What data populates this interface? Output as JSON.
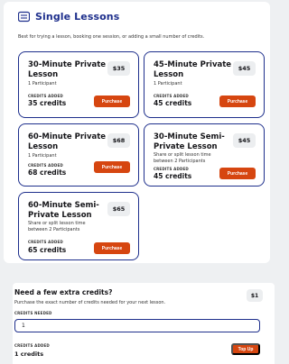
{
  "section": {
    "title": "Single Lessons",
    "description": "Best for trying a lesson, booking one session, or adding a small number of credits."
  },
  "cards": [
    {
      "title": "30-Minute Private Lesson",
      "price": "$35",
      "subtitle": "1 Participant",
      "credits_label": "CREDITS ADDED",
      "credits": "35 credits",
      "button": "Purchase"
    },
    {
      "title": "45-Minute Private Lesson",
      "price": "$45",
      "subtitle": "1 Participant",
      "credits_label": "CREDITS ADDED",
      "credits": "45 credits",
      "button": "Purchase"
    },
    {
      "title": "60-Minute Private Lesson",
      "price": "$68",
      "subtitle": "1 Participant",
      "credits_label": "CREDITS ADDED",
      "credits": "68 credits",
      "button": "Purchase"
    },
    {
      "title": "30-Minute Semi-Private Lesson",
      "price": "$45",
      "subtitle": "Share or split lesson time between 2 Participants",
      "credits_label": "CREDITS ADDED",
      "credits": "45 credits",
      "button": "Purchase"
    },
    {
      "title": "60-Minute Semi-Private Lesson",
      "price": "$65",
      "subtitle": "Share or split lesson time between 2 Participants",
      "credits_label": "CREDITS ADDED",
      "credits": "65 credits",
      "button": "Purchase"
    }
  ],
  "topup": {
    "title": "Need a few extra credits?",
    "description": "Purchase the exact number of credits needed for your next lesson.",
    "price": "$1",
    "needed_label": "CREDITS NEEDED",
    "input_value": "1",
    "added_label": "CREDITS ADDED",
    "added_value": "1 credits",
    "button": "Top Up"
  },
  "colors": {
    "accent": "#1e2f8c",
    "button": "#d64610"
  },
  "icons": {
    "section": "list-box-icon"
  }
}
